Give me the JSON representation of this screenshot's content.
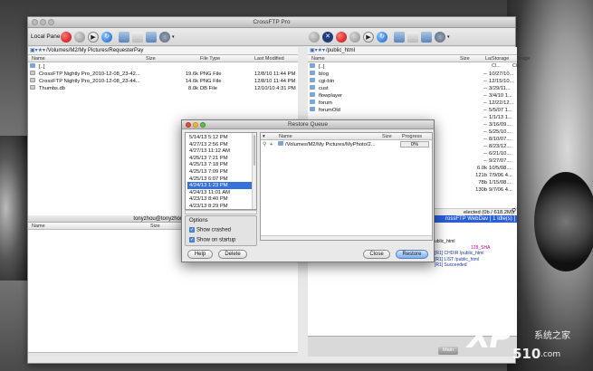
{
  "window": {
    "title": "CrossFTP Pro"
  },
  "left_pane": {
    "label": "Local Pane",
    "path": "/Volumes/M2/My Pictures/RequesterPay",
    "columns": [
      "Name",
      "Size",
      "File Type",
      "Last Modified"
    ],
    "rows": [
      {
        "name": "[..]",
        "size": "",
        "type": "",
        "modified": "",
        "kind": "folder"
      },
      {
        "name": "CrossFTP Nightly Pro_2010-12-08_23-42...",
        "size": "19.6k",
        "type": "PNG File",
        "modified": "12/8/10 11:44 PM",
        "kind": "file"
      },
      {
        "name": "CrossFTP Nightly Pro_2010-12-08_23-44...",
        "size": "14.6k",
        "type": "PNG File",
        "modified": "12/8/10 11:44 PM",
        "kind": "file"
      },
      {
        "name": "Thumbs.db",
        "size": "8.0k",
        "type": "DB File",
        "modified": "12/10/10 4:31 PM",
        "kind": "file"
      }
    ]
  },
  "right_pane": {
    "path": "/public_html",
    "columns": [
      "Name",
      "Size",
      "Last Modif...",
      "Storage Cl...",
      "Attributes"
    ],
    "rows": [
      {
        "name": "[..]",
        "size": "",
        "modified": ""
      },
      {
        "name": "blog",
        "size": "--",
        "modified": "10/27/10..."
      },
      {
        "name": "cgi-bin",
        "size": "--",
        "modified": "12/15/10..."
      },
      {
        "name": "cust",
        "size": "--",
        "modified": "3/29/11..."
      },
      {
        "name": "flowplayer",
        "size": "--",
        "modified": "3/4/10 1..."
      },
      {
        "name": "forum",
        "size": "--",
        "modified": "12/22/12..."
      },
      {
        "name": "forumOld",
        "size": "--",
        "modified": "5/5/07 1..."
      },
      {
        "name": "",
        "size": "--",
        "modified": "1/1/13 1..."
      },
      {
        "name": "",
        "size": "--",
        "modified": "3/16/09..."
      },
      {
        "name": "",
        "size": "--",
        "modified": "5/25/10..."
      },
      {
        "name": "",
        "size": "--",
        "modified": "8/10/07..."
      },
      {
        "name": "",
        "size": "--",
        "modified": "8/23/12..."
      },
      {
        "name": "",
        "size": "--",
        "modified": "6/21/10..."
      },
      {
        "name": "",
        "size": "--",
        "modified": "9/27/07..."
      },
      {
        "name": "",
        "size": "6.0k",
        "modified": "10/5/08..."
      },
      {
        "name": "",
        "size": "121b",
        "modified": "7/9/06 4..."
      },
      {
        "name": "",
        "size": "78b",
        "modified": "1/15/08..."
      },
      {
        "name": "",
        "size": "130b",
        "modified": "9/7/06 4..."
      }
    ],
    "status": "elected (0b / 618.2M)",
    "session_bar": "rossFTP WebDav [ 1 Idle(s) ]",
    "log": [
      "ublic_html",
      "[R1] CHDIR /public_html",
      "[R1] LIST /public_html",
      "[R1] Succeeded"
    ],
    "log_highlight": "128_SHA",
    "main_tab": "Main"
  },
  "left_bottom": {
    "status": "tonyzhou@tonyzhou-ma",
    "columns": [
      "Name",
      "Size"
    ]
  },
  "dialog": {
    "title": "Restore Queue",
    "dates": [
      "5/14/13 5:12 PM",
      "4/27/13 2:56 PM",
      "4/27/13 11:12 AM",
      "4/25/13 7:21 PM",
      "4/25/13 7:18 PM",
      "4/25/13 7:09 PM",
      "4/25/13 6:07 PM",
      "4/24/13 1:23 PM",
      "4/24/13 11:01 AM",
      "4/23/13 8:40 PM",
      "4/23/13 8:29 PM"
    ],
    "selected_index": 7,
    "columns": [
      "Name",
      "Size",
      "Progress"
    ],
    "queue_item": {
      "name": "/Volumes/M2/My Pictures/MyPhoto/2...",
      "progress": "0%"
    },
    "options_label": "Options",
    "show_crashed": "Show crashed",
    "show_on_startup": "Show on startup",
    "help_label": "Help",
    "delete_label": "Delete",
    "close_label": "Close",
    "restore_label": "Restore"
  },
  "watermark": {
    "logo": "XP",
    "number": "510",
    "suffix": ".com",
    "cn": "系统之家"
  }
}
